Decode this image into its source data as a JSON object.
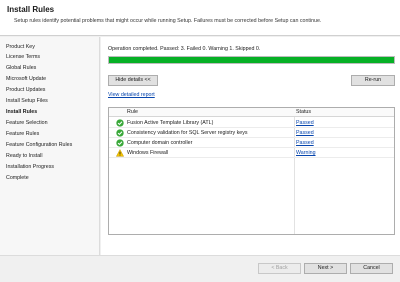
{
  "header": {
    "title": "Install Rules",
    "description": "Setup rules identify potential problems that might occur while running Setup. Failures must be corrected before Setup can continue."
  },
  "sidebar": {
    "items": [
      {
        "label": "Product Key",
        "active": false
      },
      {
        "label": "License Terms",
        "active": false
      },
      {
        "label": "Global Rules",
        "active": false
      },
      {
        "label": "Microsoft Update",
        "active": false
      },
      {
        "label": "Product Updates",
        "active": false
      },
      {
        "label": "Install Setup Files",
        "active": false
      },
      {
        "label": "Install Rules",
        "active": true
      },
      {
        "label": "Feature Selection",
        "active": false
      },
      {
        "label": "Feature Rules",
        "active": false
      },
      {
        "label": "Feature Configuration Rules",
        "active": false
      },
      {
        "label": "Ready to Install",
        "active": false
      },
      {
        "label": "Installation Progress",
        "active": false
      },
      {
        "label": "Complete",
        "active": false
      }
    ]
  },
  "main": {
    "status_line": "Operation completed. Passed: 3.   Failed 0.   Warning 1.   Skipped 0.",
    "progress_fraction": 1.0,
    "progress_color": "#06b025",
    "hide_details_label": "Hide details <<",
    "rerun_label": "Re-run",
    "view_report_label": "View detailed report",
    "grid": {
      "col_rule": "Rule",
      "col_status": "Status",
      "rows": [
        {
          "icon": "passed-check-icon",
          "rule": "Fusion Active Template Library (ATL)",
          "status": "Passed"
        },
        {
          "icon": "passed-check-icon",
          "rule": "Consistency validation for SQL Server registry keys",
          "status": "Passed"
        },
        {
          "icon": "passed-check-icon",
          "rule": "Computer domain controller",
          "status": "Passed"
        },
        {
          "icon": "warning-icon",
          "rule": "Windows Firewall",
          "status": "Warning"
        }
      ]
    }
  },
  "footer": {
    "back_label": "< Back",
    "next_label": "Next >",
    "cancel_label": "Cancel"
  }
}
